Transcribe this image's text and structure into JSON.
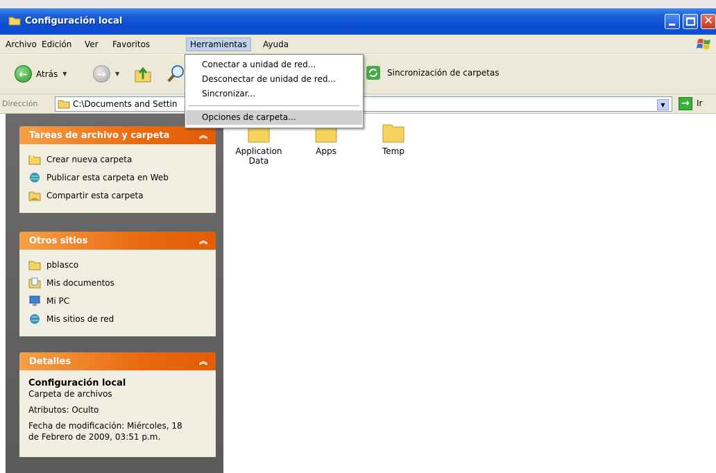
{
  "window": {
    "title": "Configuración local"
  },
  "menubar": {
    "items": [
      "Archivo",
      "Edición",
      "Ver",
      "Favoritos",
      "Herramientas",
      "Ayuda"
    ]
  },
  "toolbar": {
    "back_label": "Atrás",
    "sync_label": "Sincronización de carpetas"
  },
  "address": {
    "label": "Dirección",
    "value": "C:\\Documents and Settin",
    "go_label": "Ir"
  },
  "tools_menu": {
    "items": [
      "Conectar a unidad de red...",
      "Desconectar de unidad de red...",
      "Sincronizar...",
      "Opciones de carpeta..."
    ],
    "highlighted": "Opciones de carpeta..."
  },
  "taskpane": {
    "file_tasks": {
      "title": "Tareas de archivo y carpeta",
      "items": [
        {
          "label": "Crear nueva carpeta",
          "icon": "new-folder-icon"
        },
        {
          "label": "Publicar esta carpeta en Web",
          "icon": "publish-web-icon"
        },
        {
          "label": "Compartir esta carpeta",
          "icon": "share-folder-icon"
        }
      ]
    },
    "other_places": {
      "title": "Otros sitios",
      "items": [
        {
          "label": "pblasco",
          "icon": "folder-icon"
        },
        {
          "label": "Mis documentos",
          "icon": "my-documents-icon"
        },
        {
          "label": "Mi PC",
          "icon": "my-computer-icon"
        },
        {
          "label": "Mis sitios de red",
          "icon": "network-places-icon"
        }
      ]
    },
    "details": {
      "title": "Detalles",
      "name": "Configuración local",
      "type": "Carpeta de archivos",
      "attributes": "Atributos: Oculto",
      "modified_line1": "Fecha de modificación: Miércoles, 18",
      "modified_line2": "de Febrero de 2009, 03:51 p.m."
    }
  },
  "folders": [
    {
      "line1": "Application",
      "line2": "Data"
    },
    {
      "line1": "Apps",
      "line2": ""
    },
    {
      "line1": "Temp",
      "line2": ""
    }
  ],
  "colors": {
    "title_blue": "#0b4bd0",
    "panel_orange": "#e96a10",
    "panel_body": "#f1efe2",
    "folder_yellow": "#f7d25e"
  }
}
